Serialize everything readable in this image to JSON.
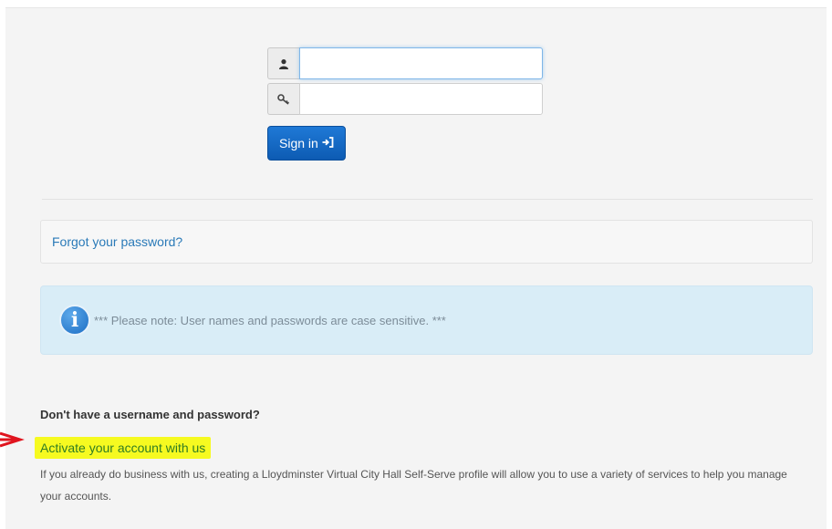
{
  "login": {
    "username_value": "",
    "password_value": "",
    "user_icon": "user-icon",
    "key_icon": "key-icon",
    "signin_label": "Sign in",
    "signin_icon": "sign-in-icon"
  },
  "forgot": {
    "link_text": "Forgot your password?"
  },
  "notice": {
    "icon": "info-icon",
    "text": "*** Please note: User names and passwords are case sensitive. ***"
  },
  "register": {
    "heading": "Don't have a username and password?",
    "link_text": "Activate your account with us",
    "description": "If you already do business with us, creating a Lloydminster Virtual City Hall Self-Serve profile will allow you to use a variety of services to help you manage your accounts."
  },
  "colors": {
    "primary_button": "#0d5bb3",
    "link": "#2a7ab8",
    "alert_bg": "#d9edf7",
    "highlight": "#f6fa20",
    "annotation_arrow": "#e0141e"
  }
}
